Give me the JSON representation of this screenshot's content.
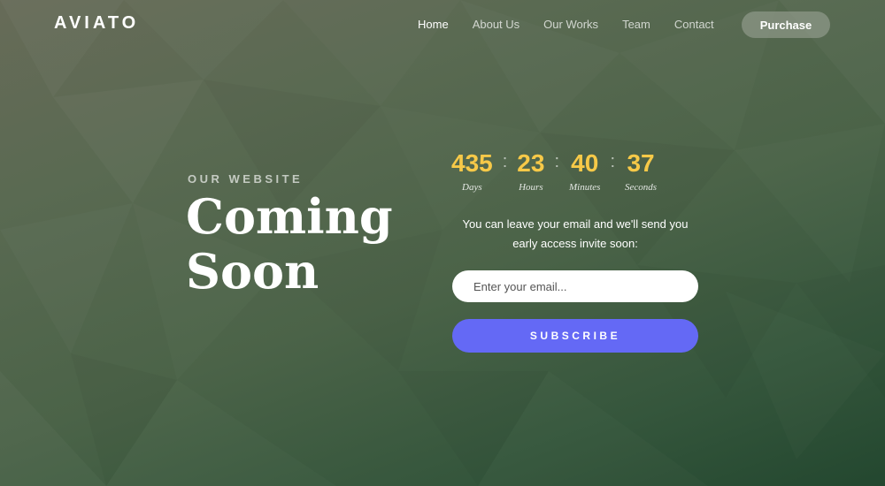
{
  "brand": {
    "logo": "AVIATO"
  },
  "nav": {
    "items": [
      {
        "label": "Home",
        "active": true
      },
      {
        "label": "About Us",
        "active": false
      },
      {
        "label": "Our Works",
        "active": false
      },
      {
        "label": "Team",
        "active": false
      },
      {
        "label": "Contact",
        "active": false
      }
    ],
    "purchase_label": "Purchase"
  },
  "hero": {
    "eyebrow": "OUR WEBSITE",
    "title_line1": "Coming",
    "title_line2": "Soon"
  },
  "countdown": {
    "separator": ":",
    "units": [
      {
        "value": "435",
        "label": "Days"
      },
      {
        "value": "23",
        "label": "Hours"
      },
      {
        "value": "40",
        "label": "Minutes"
      },
      {
        "value": "37",
        "label": "Seconds"
      }
    ]
  },
  "subscribe": {
    "info_line1": "You can leave your email and we'll send you",
    "info_line2": "early access invite soon:",
    "email_placeholder": "Enter your email...",
    "email_value": "",
    "button_label": "SUBSCRIBE"
  },
  "colors": {
    "countdown_number": "#f7c948",
    "subscribe_button": "#6469f5",
    "background_dark": "#23472f",
    "background_light": "#676b58"
  }
}
